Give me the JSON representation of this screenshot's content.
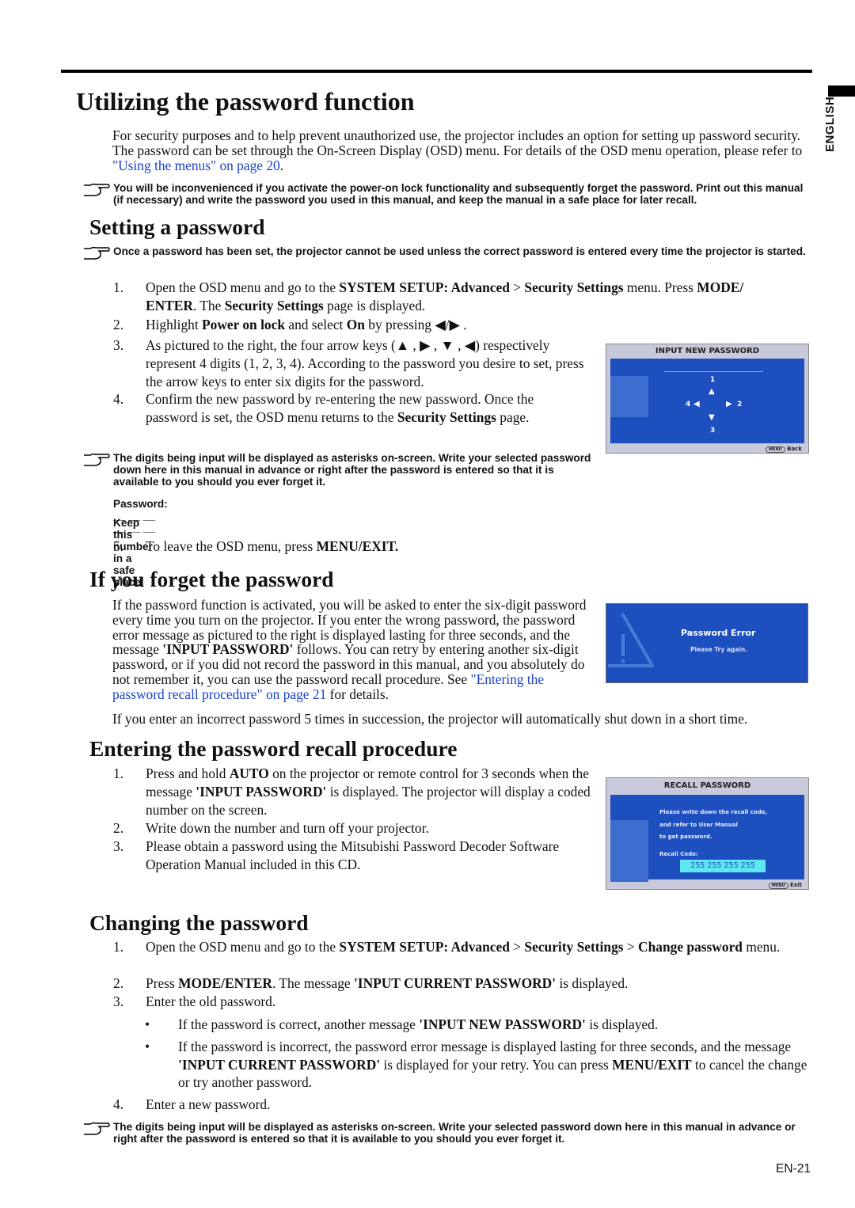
{
  "side_label": "ENGLISH",
  "page_number": "EN-21",
  "title": "Utilizing the password function",
  "intro": [
    {
      "t": "For security purposes and to help prevent unauthorized use, the projector includes an option for setting up password security. The password can be set through the On-Screen Display (OSD) menu. For details of the OSD menu operation, please refer to "
    },
    {
      "t": "\"Using the menus\" on page 20",
      "s": "l"
    },
    {
      "t": "."
    }
  ],
  "note1": "You will be inconvenienced if you activate the power-on lock functionality and subsequently forget the password. Print out this manual (if necessary) and write the password you used in this manual, and keep the manual in a safe place for later recall.",
  "setting": {
    "heading": "Setting a password",
    "note": "Once a password has been set, the projector cannot be used unless the correct password is entered every time the projector is started.",
    "steps": [
      {
        "n": "1.",
        "t": [
          {
            "t": "Open the OSD menu and go to the "
          },
          {
            "t": "SYSTEM SETUP: Advanced",
            "s": "b"
          },
          {
            "t": " > "
          },
          {
            "t": "Security Settings",
            "s": "b"
          },
          {
            "t": " menu. Press "
          },
          {
            "t": "MODE/ ENTER",
            "s": "b"
          },
          {
            "t": ". The "
          },
          {
            "t": "Security Settings",
            "s": "b"
          },
          {
            "t": " page is displayed."
          }
        ]
      },
      {
        "n": "2.",
        "t": [
          {
            "t": "Highlight "
          },
          {
            "t": "Power on lock",
            "s": "b"
          },
          {
            "t": " and select "
          },
          {
            "t": "On",
            "s": "b"
          },
          {
            "t": " by pressing ◀/▶ ."
          }
        ]
      },
      {
        "n": "3.",
        "t": [
          {
            "t": "As pictured to the right, the four arrow keys (▲ , ▶ , ▼ , ◀) respectively represent 4 digits (1, 2, 3, 4). According to the password you desire to set, press the arrow keys to enter six digits for the password."
          }
        ]
      },
      {
        "n": "4.",
        "t": [
          {
            "t": "Confirm the new password by re-entering the new password. Once the password is set, the OSD menu returns to the "
          },
          {
            "t": "Security Settings",
            "s": "b"
          },
          {
            "t": " page."
          }
        ]
      }
    ],
    "note_digits": "The digits being input will be displayed as asterisks on-screen. Write your selected password down here in this manual in advance or right after the password is entered so that it is available to you should you ever forget it.",
    "password_label": "Password: __ __ __ __ __ __",
    "keep_label": "Keep this number in a safe place.",
    "step5": {
      "n": "5.",
      "t": [
        {
          "t": "To leave the OSD menu, press "
        },
        {
          "t": "MENU/EXIT.",
          "s": "b"
        }
      ]
    }
  },
  "osd_input": {
    "title": "INPUT NEW PASSWORD",
    "digits": [
      "1",
      "2",
      "3",
      "4"
    ],
    "footer_key": "MENU",
    "footer": "Back"
  },
  "forget": {
    "heading": "If you forget the password",
    "para": [
      {
        "t": "If the password function is activated, you will be asked to enter the six-digit password every time you turn on the projector. If you enter the wrong password, the password error message as pictured to the right is displayed lasting for three seconds, and the message "
      },
      {
        "t": "'INPUT PASSWORD'",
        "s": "b"
      },
      {
        "t": " follows. You can retry by entering another six-digit password, or if you did not record the password in this manual, and you absolutely do not remember it, you can use the password recall procedure. See "
      },
      {
        "t": "\"Entering the password recall procedure\" on page 21",
        "s": "l"
      },
      {
        "t": " for details."
      }
    ],
    "para2": [
      {
        "t": "If you enter an incorrect password 5 times in succession, the projector will automatically shut down in a short time."
      }
    ]
  },
  "osd_error": {
    "title": "Password Error",
    "message": "Please Try again."
  },
  "recall": {
    "heading": "Entering the password recall procedure",
    "steps": [
      {
        "n": "1.",
        "t": [
          {
            "t": "Press and hold "
          },
          {
            "t": "AUTO",
            "s": "b"
          },
          {
            "t": " on the projector or remote control for 3 seconds when the message "
          },
          {
            "t": "'INPUT PASSWORD'",
            "s": "b"
          },
          {
            "t": " is displayed. The projector will display a coded number on the screen."
          }
        ]
      },
      {
        "n": "2.",
        "t": [
          {
            "t": "Write down the number and turn off your projector."
          }
        ]
      },
      {
        "n": "3.",
        "t": [
          {
            "t": "Please obtain a password using the Mitsubishi Password Decoder Software Operation Manual included in this CD."
          }
        ]
      }
    ]
  },
  "osd_recall": {
    "title": "RECALL PASSWORD",
    "lines": [
      "Please write down the recall code,",
      "and refer to User Manual",
      "to get password."
    ],
    "code_label": "Recall Code:",
    "code": "255 255 255 255",
    "footer_key": "MENU",
    "footer": "Exit"
  },
  "change": {
    "heading": "Changing the password",
    "steps": [
      {
        "n": "1.",
        "t": [
          {
            "t": "Open the OSD menu and go to the "
          },
          {
            "t": "SYSTEM SETUP: Advanced",
            "s": "b"
          },
          {
            "t": " > "
          },
          {
            "t": "Security Settings",
            "s": "b"
          },
          {
            "t": " > "
          },
          {
            "t": "Change password",
            "s": "b"
          },
          {
            "t": " menu."
          }
        ]
      },
      {
        "n": "2.",
        "t": [
          {
            "t": "Press "
          },
          {
            "t": "MODE/ENTER",
            "s": "b"
          },
          {
            "t": ". The message "
          },
          {
            "t": "'INPUT CURRENT PASSWORD'",
            "s": "b"
          },
          {
            "t": " is displayed."
          }
        ]
      },
      {
        "n": "3.",
        "t": [
          {
            "t": "Enter the old password."
          }
        ]
      },
      {
        "n": "•",
        "t": [
          {
            "t": "If the password is correct, another message "
          },
          {
            "t": "'INPUT NEW PASSWORD'",
            "s": "b"
          },
          {
            "t": " is displayed."
          }
        ]
      },
      {
        "n": "•",
        "t": [
          {
            "t": "If the password is incorrect, the password error message is displayed lasting for three seconds, and the message "
          },
          {
            "t": "'INPUT CURRENT PASSWORD'",
            "s": "b"
          },
          {
            "t": " is displayed for your retry. You can press "
          },
          {
            "t": "MENU/EXIT",
            "s": "b"
          },
          {
            "t": " to cancel the change or try another password."
          }
        ]
      },
      {
        "n": "4.",
        "t": [
          {
            "t": "Enter a new password."
          }
        ]
      }
    ],
    "note": "The digits being input will be displayed as asterisks on-screen. Write your selected password down here in this manual in advance or right after the password is entered so that it is available to you should you ever forget it."
  },
  "colors": {
    "osd_blue": "#1e4fbf",
    "link": "#1a3fc9",
    "code_bg": "#5fe6f0"
  }
}
